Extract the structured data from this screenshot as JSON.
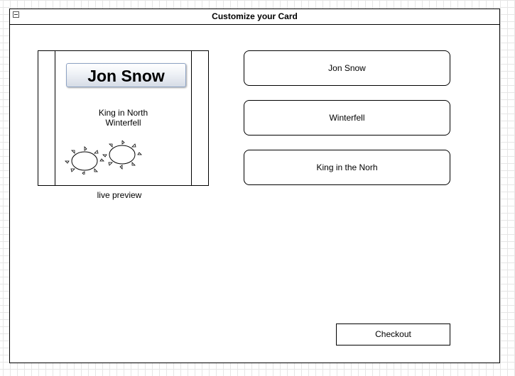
{
  "window": {
    "title": "Customize your Card",
    "collapse_icon": "minus-box-icon"
  },
  "preview": {
    "name": "Jon Snow",
    "line1": "King in North",
    "line2": "Winterfell",
    "decoration_icon": "sun-icon",
    "caption": "live preview"
  },
  "fields": {
    "name_value": "Jon Snow",
    "place_value": "Winterfell",
    "title_value": "King in the Norh"
  },
  "actions": {
    "checkout_label": "Checkout"
  },
  "colors": {
    "border": "#000000",
    "grid": "#e6e6e6",
    "banner_border": "#8ea3c4"
  }
}
